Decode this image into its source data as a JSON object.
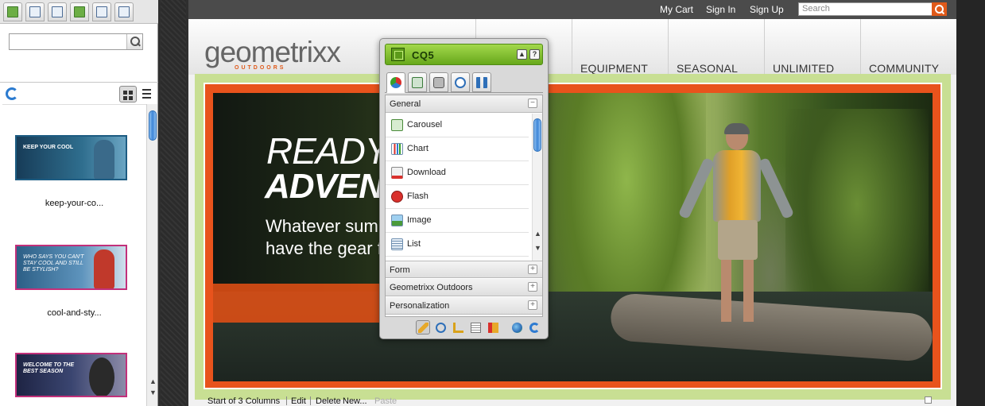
{
  "finder": {
    "tab_icons": [
      "images-icon",
      "document-icon",
      "movie-icon",
      "flash-icon",
      "page-icon",
      "paragraph-icon"
    ],
    "search": {
      "value": "",
      "placeholder": ""
    },
    "refresh_icon": "refresh-icon",
    "view_icons": [
      "grid-view-icon",
      "list-view-icon"
    ],
    "assets": [
      {
        "name": "keep-your-co...",
        "thumb_text": "KEEP YOUR COOL",
        "thumb_color": "#1e4a6e"
      },
      {
        "name": "cool-and-sty...",
        "thumb_text": "WHO SAYS YOU CAN'T STAY COOL AND STILL BE STYLISH?",
        "thumb_color": "#3a6f9a"
      },
      {
        "name": "",
        "thumb_text": "WELCOME TO THE BEST SEASON",
        "thumb_color": "#2a2f52"
      }
    ]
  },
  "site": {
    "top_links": [
      "My Cart",
      "Sign In",
      "Sign Up"
    ],
    "search_placeholder": "Search",
    "logo": "geometrixx",
    "logo_sub": "OUTDOORS",
    "nav": [
      "EQUIPMENT",
      "SEASONAL",
      "UNLIMITED",
      "COMMUNITY"
    ],
    "hero": {
      "line1": "READY",
      "line2": "ADVEN",
      "line3a": "Whatever summ",
      "line3b": "have the gear fo"
    },
    "footer": {
      "start": "Start of 3 Columns",
      "edit": "Edit",
      "delete": "Delete",
      "new": "New...",
      "paste": "Paste"
    }
  },
  "sidekick": {
    "title": "CQ5",
    "collapse_label": "▲",
    "help_label": "?",
    "tabs": [
      "components-icon",
      "page-icon",
      "lock-icon",
      "versioning-icon",
      "workflow-icon"
    ],
    "groups": {
      "general": "General",
      "form": "Form",
      "geometrixx": "Geometrixx Outdoors",
      "personalization": "Personalization"
    },
    "general_expanded_symbol": "−",
    "collapsed_symbol": "+",
    "components": [
      "Carousel",
      "Chart",
      "Download",
      "Flash",
      "Image",
      "List"
    ],
    "tools": [
      "edit-icon",
      "preview-icon",
      "design-icon",
      "scaffolding-icon",
      "client-context-icon",
      "website-icon",
      "refresh-icon"
    ]
  },
  "colors": {
    "accent_orange": "#e8531c",
    "sidekick_green": "#67a81b",
    "frame_green": "#c8df93"
  }
}
